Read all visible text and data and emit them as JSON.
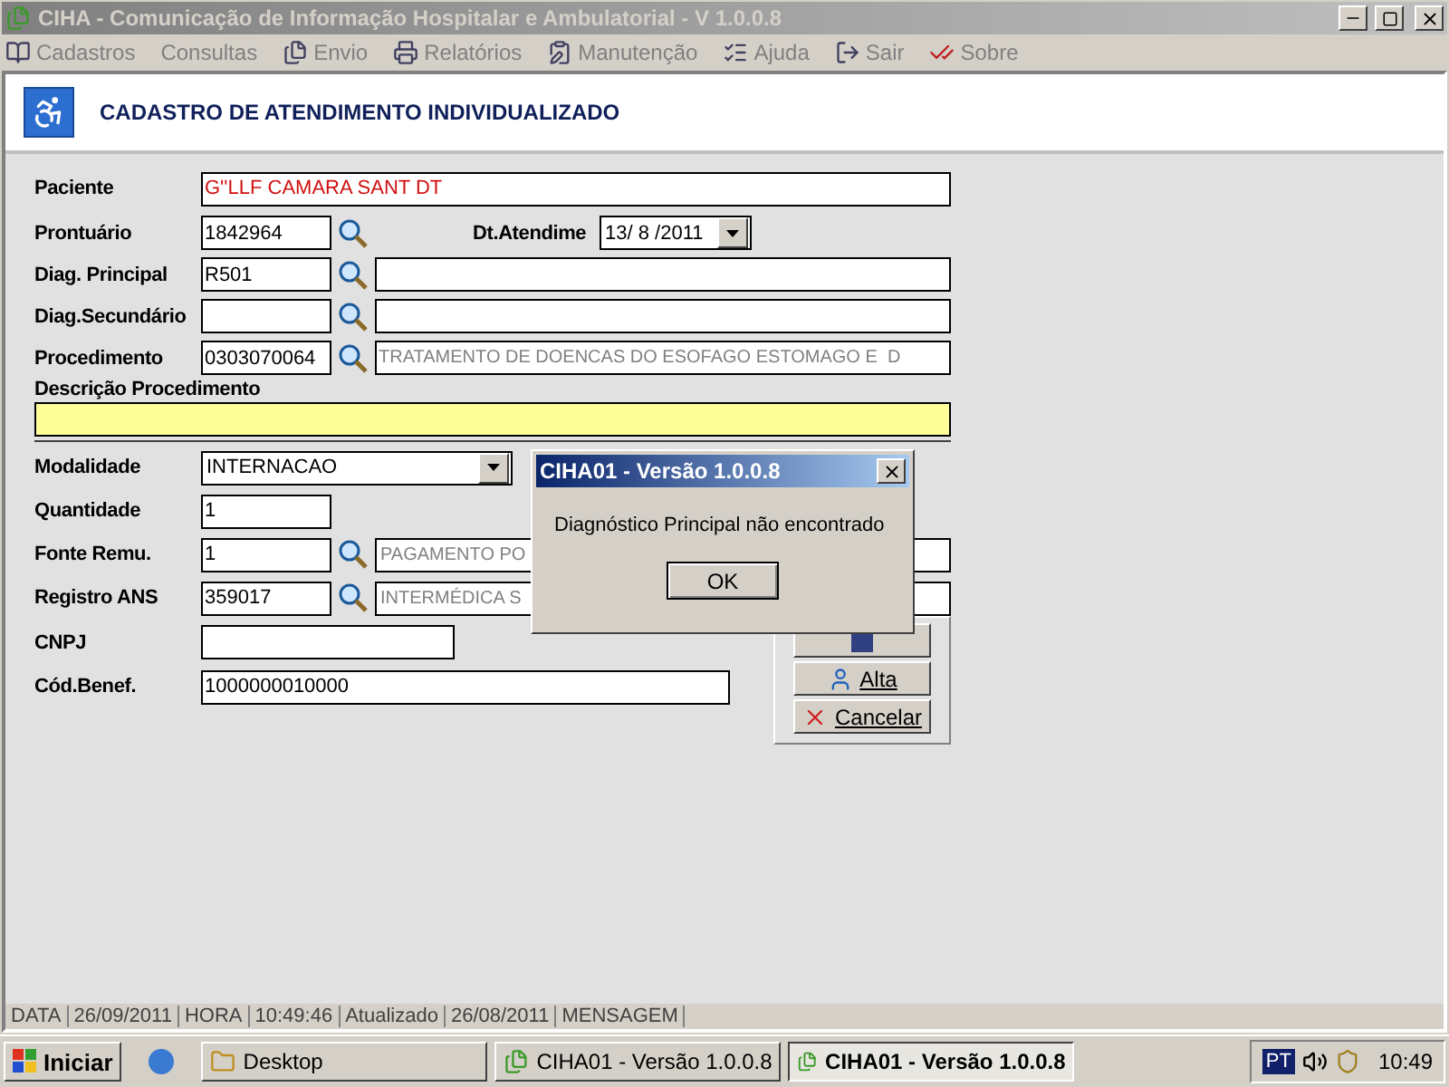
{
  "window": {
    "title": "CIHA - Comunicação de Informação Hospitalar e Ambulatorial - V 1.0.0.8",
    "active": false
  },
  "menu": [
    {
      "label": "Cadastros"
    },
    {
      "label": "Consultas"
    },
    {
      "label": "Envio"
    },
    {
      "label": "Relatórios"
    },
    {
      "label": "Manutenção"
    },
    {
      "label": "Ajuda"
    },
    {
      "label": "Sair"
    },
    {
      "label": "Sobre"
    }
  ],
  "header": {
    "title": "CADASTRO DE ATENDIMENTO INDIVIDUALIZADO"
  },
  "patient": {
    "label": "Paciente",
    "value": "G''LLF CAMARA SANT DT"
  },
  "record": {
    "label": "Prontuário",
    "value": "1842964",
    "date_label": "Dt.Atendime",
    "date": "13/ 8 /2011"
  },
  "lookups": [
    {
      "label": "Diag. Principal",
      "code": "R501"
    },
    {
      "label": "Diag.Secundário"
    },
    {
      "label": "Procedimento",
      "code": "0303070064",
      "description": "TRATAMENTO DE DOENCAS DO ESOFAGO ESTOMAGO E  D"
    }
  ],
  "procedure_description": {
    "label": "Descrição Procedimento"
  },
  "modality": {
    "label": "Modalidade",
    "value": "INTERNACAO"
  },
  "quantity": {
    "label": "Quantidade",
    "value": "1"
  },
  "payers": [
    {
      "label": "Fonte Remu.",
      "code": "1",
      "description": "PAGAMENTO PO"
    },
    {
      "label": "Registro ANS",
      "code": "359017",
      "description": "INTERMÉDICA S"
    }
  ],
  "cnpj": {
    "label": "CNPJ"
  },
  "beneficiary": {
    "label": "Cód.Benef.",
    "value": "1000000010000"
  },
  "actions": [
    {
      "kind": "save"
    },
    {
      "kind": "discharge",
      "label": "Alta"
    },
    {
      "kind": "cancel",
      "label": "Cancelar"
    }
  ],
  "dialog": {
    "title": "CIHA01 - Versão 1.0.0.8",
    "message": "Diagnóstico Principal não encontrado",
    "button": "OK"
  },
  "status_bar": [
    "DATA",
    "26/09/2011",
    "HORA",
    "10:49:46",
    "Atualizado",
    "26/08/2011",
    "MENSAGEM"
  ],
  "taskbar": {
    "start": "Iniciar",
    "tasks": [
      {
        "label": "Desktop",
        "kind": "folder",
        "selected": false
      },
      {
        "label": "CIHA01 - Versão 1.0.0.8",
        "kind": "app",
        "selected": false
      },
      {
        "label": "CIHA01 - Versão 1.0.0.8",
        "kind": "app",
        "selected": true
      }
    ],
    "language": "PT",
    "clock": "10:49"
  }
}
